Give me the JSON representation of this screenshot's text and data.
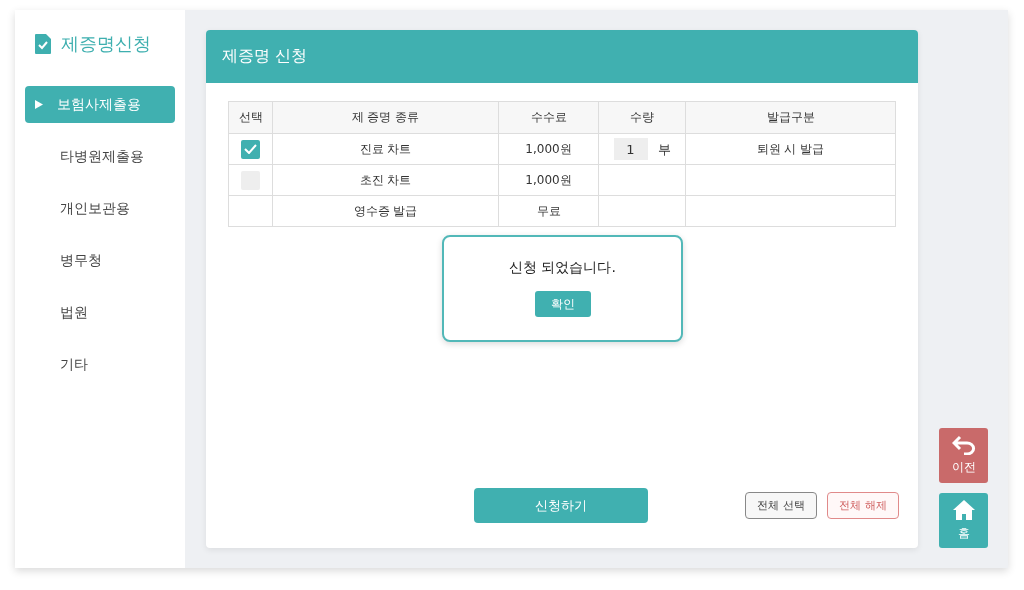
{
  "sidebar": {
    "title": "제증명신청",
    "items": [
      {
        "label": "보험사제출용",
        "selected": true
      },
      {
        "label": "타병원제출용",
        "selected": false
      },
      {
        "label": "개인보관용",
        "selected": false
      },
      {
        "label": "병무청",
        "selected": false
      },
      {
        "label": "법원",
        "selected": false
      },
      {
        "label": "기타",
        "selected": false
      }
    ]
  },
  "panel": {
    "title": "제증명 신청"
  },
  "table": {
    "columns": [
      "선택",
      "제 증명 종류",
      "수수료",
      "수량",
      "발급구분"
    ],
    "rows": [
      {
        "checked": true,
        "name": "진료 차트",
        "fee": "1,000원",
        "quantity": "1",
        "unit": "부",
        "issue": "퇴원 시 발급"
      },
      {
        "checked": false,
        "name": "초진 차트",
        "fee": "1,000원"
      },
      {
        "name": "영수증 발급",
        "fee": "무료"
      }
    ]
  },
  "dialog": {
    "message": "신청 되었습니다.",
    "button": "확인"
  },
  "submit_button": "신청하기",
  "select_all_button": "전체 선택",
  "deselect_all_button": "전체 해제",
  "side_buttons": [
    {
      "kind": "back",
      "label": "이전"
    },
    {
      "kind": "home",
      "label": "홈"
    }
  ]
}
